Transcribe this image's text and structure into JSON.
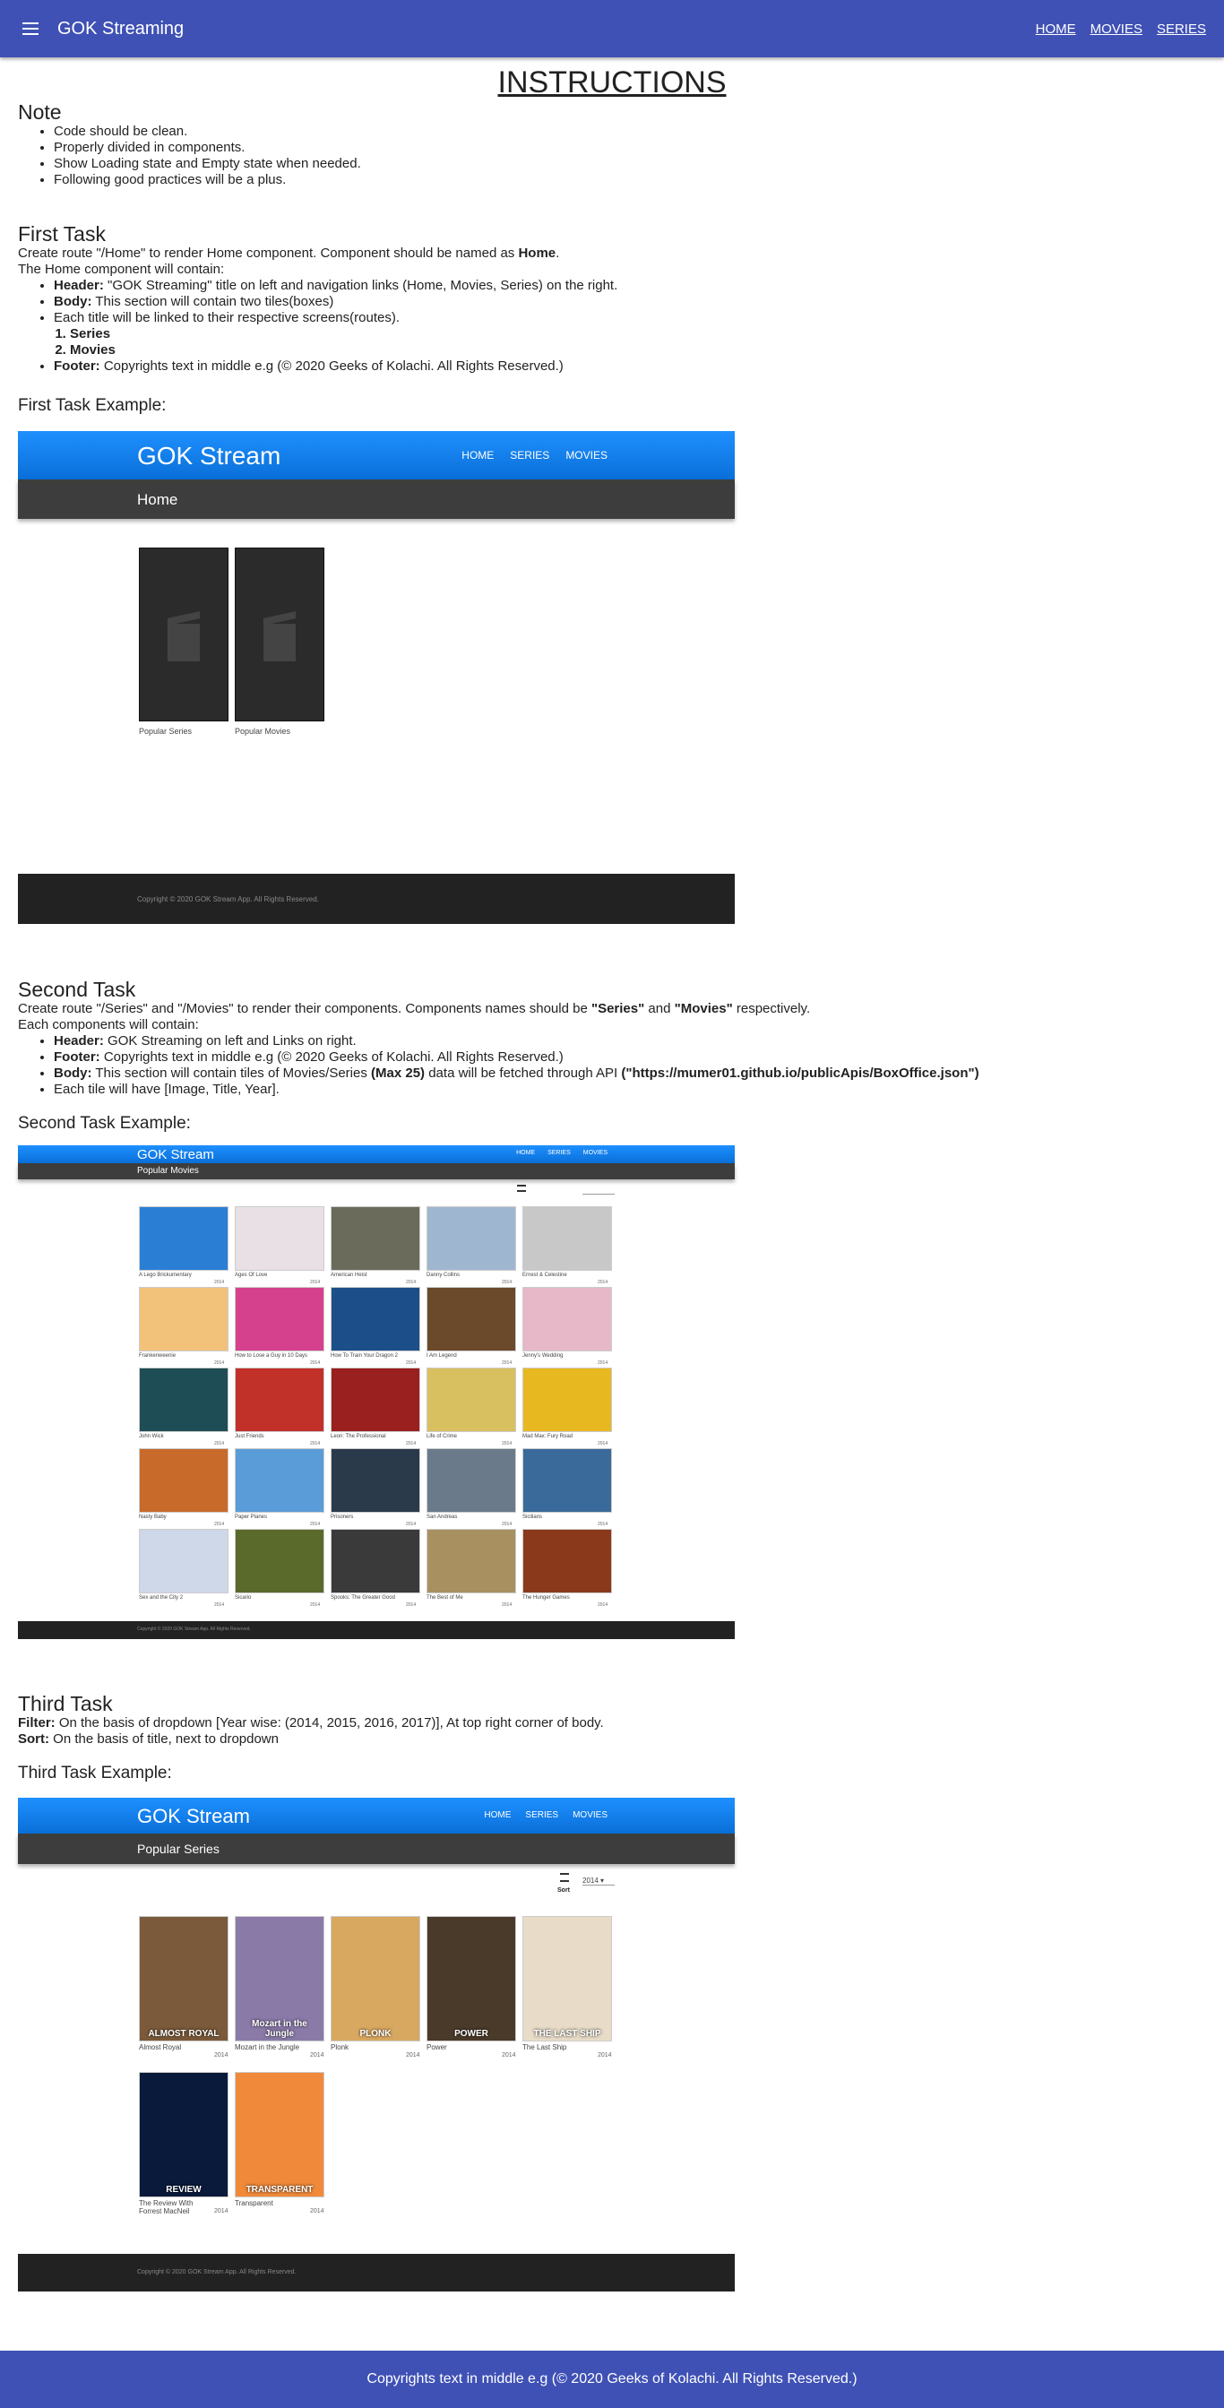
{
  "appbar": {
    "title": "GOK Streaming",
    "links": [
      "HOME",
      "MOVIES",
      "SERIES"
    ]
  },
  "main_title": "INSTRUCTIONS",
  "note": {
    "heading": "Note",
    "items": [
      "Code should be clean.",
      "Properly divided in components.",
      "Show Loading state and Empty state when needed.",
      "Following good practices will be a plus."
    ]
  },
  "first_task": {
    "heading": "First Task",
    "intro_pre": "Create route \"/Home\" to render Home component. Component should be named as ",
    "intro_bold": "Home",
    "intro_post": ".",
    "contains": "The Home component will contain:",
    "header_label": "Header:",
    "header_text": " \"GOK Streaming\" title on left and navigation links (Home, Movies, Series) on the right.",
    "body_label": "Body:",
    "body_text": " This section will contain two tiles(boxes)",
    "linked_text": "Each title will be linked to their respective screens(routes).",
    "sub_items": [
      "Series",
      "Movies"
    ],
    "footer_label": "Footer:",
    "footer_text": " Copyrights text in middle e.g (© 2020 Geeks of Kolachi. All Rights Reserved.)",
    "example_heading": "First Task Example:"
  },
  "mock1": {
    "brand": "GOK Stream",
    "links": [
      "HOME",
      "SERIES",
      "MOVIES"
    ],
    "sub": "Home",
    "tiles": [
      "Popular Series",
      "Popular Movies"
    ],
    "footer": "Copyright © 2020 GOK Stream App. All Rights Reserved."
  },
  "second_task": {
    "heading": "Second Task",
    "intro_pre": "Create route \"/Series\" and \"/Movies\" to render their components. Components names should be ",
    "b1": "\"Series\"",
    "mid": " and ",
    "b2": "\"Movies\"",
    "intro_post": " respectively.",
    "contains": "Each components will contain:",
    "header_label": "Header:",
    "header_text": " GOK Streaming on left and Links on right.",
    "footer_label": "Footer:",
    "footer_text": " Copyrights text in middle e.g (© 2020 Geeks of Kolachi. All Rights Reserved.)",
    "body_label": "Body:",
    "body_text": " This section will contain tiles of Movies/Series ",
    "body_max": "(Max 25)",
    "body_text2": " data will be fetched through API ",
    "body_api": "(\"https://mumer01.github.io/publicApis/BoxOffice.json\")",
    "tile_text": "Each tile will have [Image, Title, Year].",
    "example_heading": "Second Task Example:"
  },
  "mock2": {
    "brand": "GOK Stream",
    "links": [
      "HOME",
      "SERIES",
      "MOVIES"
    ],
    "sub": "Popular Movies",
    "posters": [
      {
        "title": "A Lego Brickumentary",
        "year": "2014",
        "color": "#2a7fd4"
      },
      {
        "title": "Ages Of Love",
        "year": "2014",
        "color": "#e8e0e4"
      },
      {
        "title": "American Heist",
        "year": "2014",
        "color": "#6b6b5c"
      },
      {
        "title": "Danny Collins",
        "year": "2014",
        "color": "#9fb6d0"
      },
      {
        "title": "Ernest & Celestine",
        "year": "2014",
        "color": "#c8c8c8"
      },
      {
        "title": "Frankenweenie",
        "year": "2014",
        "color": "#f2c27a"
      },
      {
        "title": "How to Lose a Guy in 10 Days",
        "year": "2014",
        "color": "#d6418e"
      },
      {
        "title": "How To Train Your Dragon 2",
        "year": "2014",
        "color": "#1c4f8a"
      },
      {
        "title": "I Am Legend",
        "year": "2014",
        "color": "#6a4a2a"
      },
      {
        "title": "Jenny's Wedding",
        "year": "2014",
        "color": "#e6b8c8"
      },
      {
        "title": "John Wick",
        "year": "2014",
        "color": "#1f4d55"
      },
      {
        "title": "Just Friends",
        "year": "2014",
        "color": "#c2302a"
      },
      {
        "title": "Leon: The Professional",
        "year": "2014",
        "color": "#9a1f1f"
      },
      {
        "title": "Life of Crime",
        "year": "2014",
        "color": "#d8c060"
      },
      {
        "title": "Mad Max: Fury Road",
        "year": "2014",
        "color": "#e8b820"
      },
      {
        "title": "Nasty Baby",
        "year": "2014",
        "color": "#c86a2a"
      },
      {
        "title": "Paper Planes",
        "year": "2014",
        "color": "#5a9cd8"
      },
      {
        "title": "Prisoners",
        "year": "2014",
        "color": "#2a3a4a"
      },
      {
        "title": "San Andreas",
        "year": "2014",
        "color": "#6a7a8a"
      },
      {
        "title": "Sicilians",
        "year": "2014",
        "color": "#3a6a9a"
      },
      {
        "title": "Sex and the City 2",
        "year": "2014",
        "color": "#cfd8e8"
      },
      {
        "title": "Sicario",
        "year": "2014",
        "color": "#5a6a2a"
      },
      {
        "title": "Spooks: The Greater Good",
        "year": "2014",
        "color": "#3a3a3a"
      },
      {
        "title": "The Best of Me",
        "year": "2014",
        "color": "#a89060"
      },
      {
        "title": "The Hunger Games",
        "year": "2014",
        "color": "#8a3a1a"
      }
    ],
    "footer": "Copyright © 2020 GOK Stream App. All Rights Reserved."
  },
  "third_task": {
    "heading": "Third Task",
    "filter_label": "Filter:",
    "filter_text": " On the basis of dropdown [Year wise: (2014, 2015, 2016, 2017)], At top right corner of body.",
    "sort_label": "Sort:",
    "sort_text": " On the basis of title, next to dropdown",
    "example_heading": "Third Task Example:"
  },
  "mock3": {
    "brand": "GOK Stream",
    "links": [
      "HOME",
      "SERIES",
      "MOVIES"
    ],
    "sub": "Popular Series",
    "sort_label": "Sort",
    "year_value": "2014",
    "posters": [
      {
        "title": "Almost Royal",
        "year": "2014",
        "color": "#7a5a3a",
        "text": "ALMOST ROYAL"
      },
      {
        "title": "Mozart in the Jungle",
        "year": "2014",
        "color": "#8a7aa8",
        "text": "Mozart in the Jungle"
      },
      {
        "title": "Plonk",
        "year": "2014",
        "color": "#d8a860",
        "text": "PLONK"
      },
      {
        "title": "Power",
        "year": "2014",
        "color": "#4a3a2a",
        "text": "POWER"
      },
      {
        "title": "The Last Ship",
        "year": "2014",
        "color": "#e8dcc8",
        "text": "THE LAST SHIP"
      },
      {
        "title": "The Review With Forrest MacNeil",
        "year": "2014",
        "color": "#0a1a3a",
        "text": "REVIEW"
      },
      {
        "title": "Transparent",
        "year": "2014",
        "color": "#f08a3a",
        "text": "TRANSPARENT"
      }
    ],
    "footer": "Copyright © 2020 GOK Stream App. All Rights Reserved."
  },
  "bottom_footer": "Copyrights text in middle e.g (© 2020 Geeks of Kolachi. All Rights Reserved.)"
}
